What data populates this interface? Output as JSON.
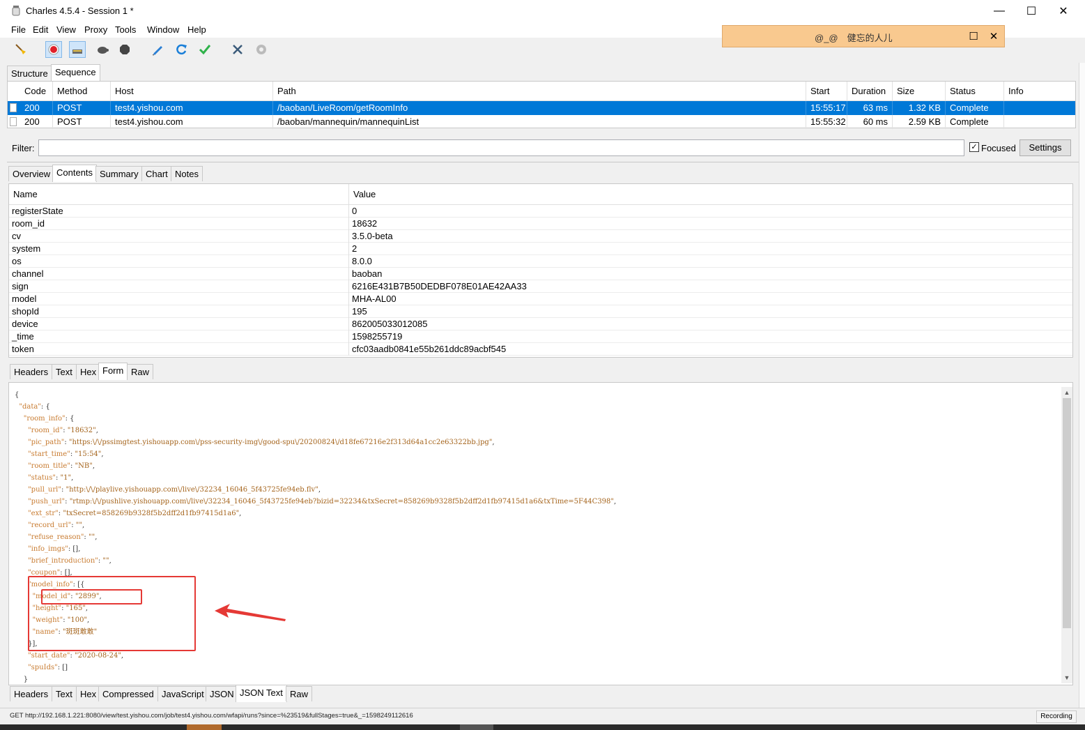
{
  "window": {
    "title": "Charles 4.5.4 - Session 1 *",
    "minimize": "—",
    "maximize": "☐",
    "close": "✕"
  },
  "menu": [
    "File",
    "Edit",
    "View",
    "Proxy",
    "Tools",
    "Window",
    "Help"
  ],
  "toast": {
    "text": "@_@　健忘的人儿",
    "restore": "☐",
    "close": "✕"
  },
  "top_tabs": [
    "Structure",
    "Sequence"
  ],
  "sequence": {
    "columns": [
      "Code",
      "Method",
      "Host",
      "Path",
      "Start",
      "Duration",
      "Size",
      "Status",
      "Info"
    ],
    "rows": [
      {
        "code": "200",
        "method": "POST",
        "host": "test4.yishou.com",
        "path": "/baoban/LiveRoom/getRoomInfo",
        "start": "15:55:17",
        "duration": "63 ms",
        "size": "1.32 KB",
        "status": "Complete",
        "info": ""
      },
      {
        "code": "200",
        "method": "POST",
        "host": "test4.yishou.com",
        "path": "/baoban/mannequin/mannequinList",
        "start": "15:55:32",
        "duration": "60 ms",
        "size": "2.59 KB",
        "status": "Complete",
        "info": ""
      }
    ]
  },
  "filter": {
    "label": "Filter:",
    "value": "",
    "focused_label": "Focused",
    "focused_checked": "✓",
    "settings_label": "Settings"
  },
  "detail_tabs": [
    "Overview",
    "Contents",
    "Summary",
    "Chart",
    "Notes"
  ],
  "form": {
    "columns": [
      "Name",
      "Value"
    ],
    "rows": [
      [
        "registerState",
        "0"
      ],
      [
        "room_id",
        "18632"
      ],
      [
        "cv",
        "3.5.0-beta"
      ],
      [
        "system",
        "2"
      ],
      [
        "os",
        "8.0.0"
      ],
      [
        "channel",
        "baoban"
      ],
      [
        "sign",
        "6216E431B7B50DEDBF078E01AE42AA33"
      ],
      [
        "model",
        "MHA-AL00"
      ],
      [
        "shopId",
        "195"
      ],
      [
        "device",
        "862005033012085"
      ],
      [
        "_time",
        "1598255719"
      ],
      [
        "token",
        "cfc03aadb0841e55b261ddc89acbf545"
      ]
    ]
  },
  "request_tabs": [
    "Headers",
    "Text",
    "Hex",
    "Form",
    "Raw"
  ],
  "json_lines": [
    "{",
    "  \"data\": {",
    "    \"room_info\": {",
    "      \"room_id\": \"18632\",",
    "      \"pic_path\": \"https:\\/\\/pssimgtest.yishouapp.com\\/pss-security-img\\/good-spu\\/20200824\\/d18fe67216e2f313d64a1cc2e63322bb.jpg\",",
    "      \"start_time\": \"15:54\",",
    "      \"room_title\": \"NB\",",
    "      \"status\": \"1\",",
    "      \"pull_url\": \"http:\\/\\/playlive.yishouapp.com\\/live\\/32234_16046_5f43725fe94eb.flv\",",
    "      \"push_url\": \"rtmp:\\/\\/pushlive.yishouapp.com\\/live\\/32234_16046_5f43725fe94eb?bizid=32234&txSecret=858269b9328f5b2dff2d1fb97415d1a6&txTime=5F44C398\",",
    "      \"ext_str\": \"txSecret=858269b9328f5b2dff2d1fb97415d1a6\",",
    "      \"record_url\": \"\",",
    "      \"refuse_reason\": \"\",",
    "      \"info_imgs\": [],",
    "      \"brief_introduction\": \"\",",
    "      \"coupon\": [],",
    "      \"model_info\": [{",
    "        \"model_id\": \"2899\",",
    "        \"height\": \"165\",",
    "        \"weight\": \"100\",",
    "        \"name\": \"斑斑敢敢\"",
    "      }],",
    "      \"start_date\": \"2020-08-24\",",
    "      \"spuIds\": []",
    "    }"
  ],
  "response_tabs": [
    "Headers",
    "Text",
    "Hex",
    "Compressed",
    "JavaScript",
    "JSON",
    "JSON Text",
    "Raw"
  ],
  "status": {
    "text": "GET http://192.168.1.221:8080/view/test.yishou.com/job/test4.yishou.com/wfapi/runs?since=%23519&fullStages=true&_=1598249112616",
    "recording": "Recording"
  },
  "colors": {
    "selection": "#0078d7",
    "json_key": "#c87b30",
    "annotation": "#e53935",
    "toast_bg": "#f9c98f"
  }
}
